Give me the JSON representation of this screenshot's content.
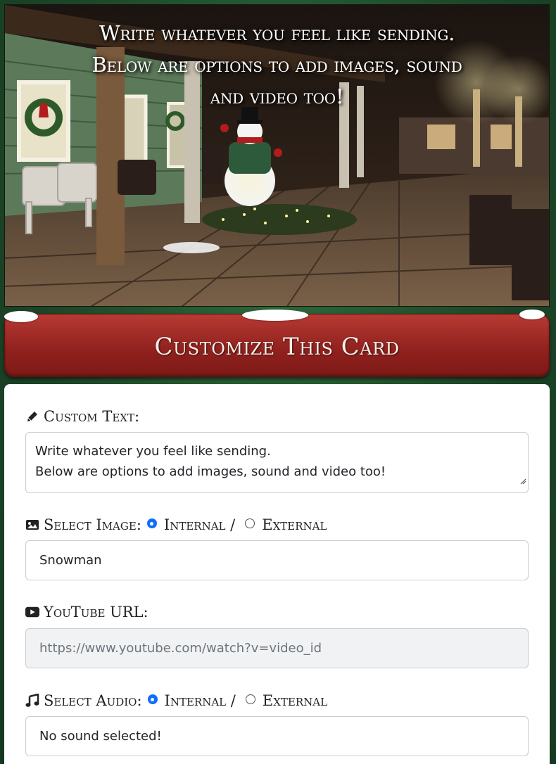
{
  "hero": {
    "line1": "Write whatever you feel like sending.",
    "line2": "Below are options to add images, sound",
    "line3": "and video too!"
  },
  "banner": {
    "title": "Customize This Card"
  },
  "form": {
    "custom_text": {
      "label": "Custom Text:",
      "icon": "pencil-icon",
      "value_line1": "Write whatever you feel like sending.",
      "value_line2": "Below are options to add images, sound and video too!"
    },
    "image": {
      "label": "Select Image:",
      "icon": "image-icon",
      "option_internal": "Internal /",
      "option_external": "External",
      "selected": "internal",
      "value": "Snowman"
    },
    "youtube": {
      "label": "YouTube URL:",
      "icon": "youtube-icon",
      "placeholder": "https://www.youtube.com/watch?v=video_id"
    },
    "audio": {
      "label": "Select Audio:",
      "icon": "music-note-icon",
      "option_internal": "Internal /",
      "option_external": "External",
      "selected": "internal",
      "value": "No sound selected!"
    }
  },
  "colors": {
    "background": "#1f4a2a",
    "banner": "#9b2a26",
    "accent": "#0d6efd"
  }
}
